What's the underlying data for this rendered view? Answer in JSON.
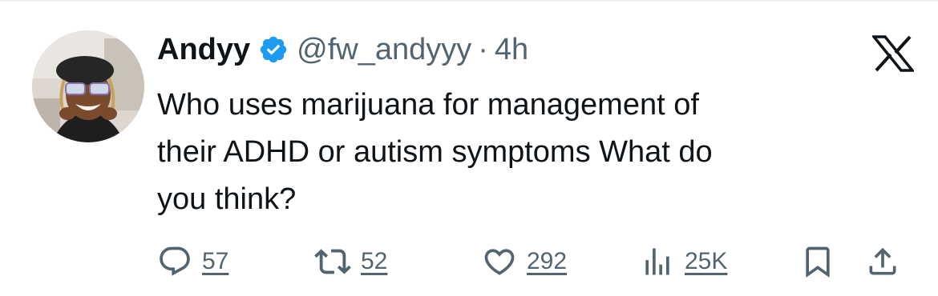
{
  "tweet": {
    "display_name": "Andyy",
    "handle": "@fw_andyyy",
    "separator": "·",
    "timestamp": "4h",
    "text": "Who uses marijuana for management of\ntheir ADHD or autism symptoms What do\nyou think?"
  },
  "actions": {
    "replies": "57",
    "reposts": "52",
    "likes": "292",
    "views": "25K"
  },
  "icons": {
    "verified": "verified-badge-icon",
    "platform": "x-logo-icon",
    "reply": "reply-icon",
    "repost": "repost-icon",
    "like": "heart-icon",
    "views": "views-icon",
    "bookmark": "bookmark-icon",
    "share": "share-icon"
  },
  "colors": {
    "text_primary": "#0f1419",
    "text_secondary": "#536471",
    "verified_blue": "#1d9bf0"
  }
}
